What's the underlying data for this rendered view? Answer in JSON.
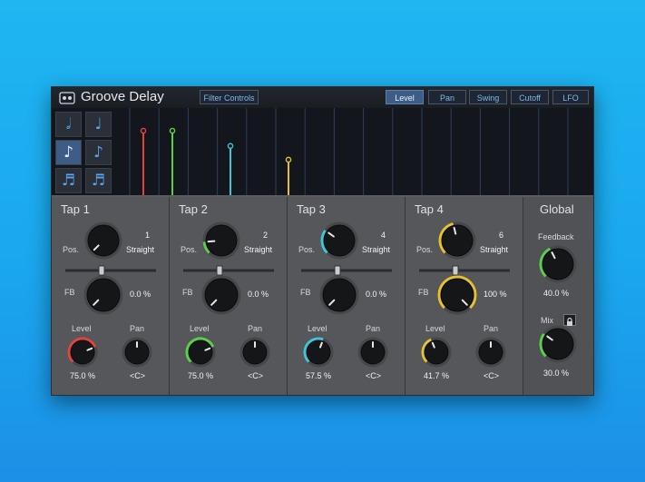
{
  "header": {
    "title": "Groove Delay",
    "filter_button": "Filter Controls",
    "tabs": [
      {
        "label": "Level",
        "active": true
      },
      {
        "label": "Pan",
        "active": false
      },
      {
        "label": "Swing",
        "active": false
      },
      {
        "label": "Cutoff",
        "active": false
      },
      {
        "label": "LFO",
        "active": false
      }
    ]
  },
  "note_buttons": [
    {
      "glyph": "𝅗𝅥",
      "icon": "half-note-icon",
      "selected": false
    },
    {
      "glyph": "♩",
      "icon": "quarter-note-icon",
      "selected": false
    },
    {
      "glyph": "♪",
      "icon": "eighth-note-icon",
      "selected": true
    },
    {
      "glyph": "♪",
      "icon": "eighth-note-icon",
      "selected": false
    },
    {
      "glyph": "♬",
      "icon": "sixteenth-note-icon",
      "selected": false
    },
    {
      "glyph": "♬",
      "icon": "thirtysecond-note-icon",
      "selected": false
    }
  ],
  "timeline_markers": [
    {
      "color": "#e0443c",
      "level": 0.75
    },
    {
      "color": "#5ccf4a",
      "level": 0.75
    },
    {
      "color": "#3ec6d8",
      "level": 0.575
    },
    {
      "color": "#e6c12e",
      "level": 0.417
    }
  ],
  "labels": {
    "pos": "Pos.",
    "fb": "FB",
    "level": "Level",
    "pan": "Pan"
  },
  "taps": [
    {
      "title": "Tap 1",
      "pos_value": "1",
      "pos_mode": "Straight",
      "fb_value": "0.0 %",
      "level_value": "75.0 %",
      "pan_value": "<C>",
      "accent": "#e0443c",
      "level": 0.75,
      "fb": 0.0,
      "pos": 0.0
    },
    {
      "title": "Tap 2",
      "pos_value": "2",
      "pos_mode": "Straight",
      "fb_value": "0.0 %",
      "level_value": "75.0 %",
      "pan_value": "<C>",
      "accent": "#5ccf4a",
      "level": 0.75,
      "fb": 0.0,
      "pos": 0.15
    },
    {
      "title": "Tap 3",
      "pos_value": "4",
      "pos_mode": "Straight",
      "fb_value": "0.0 %",
      "level_value": "57.5 %",
      "pan_value": "<C>",
      "accent": "#3ec6d8",
      "level": 0.575,
      "fb": 0.0,
      "pos": 0.3
    },
    {
      "title": "Tap 4",
      "pos_value": "6",
      "pos_mode": "Straight",
      "fb_value": "100 %",
      "level_value": "41.7 %",
      "pan_value": "<C>",
      "accent": "#e6c12e",
      "level": 0.417,
      "fb": 1.0,
      "pos": 0.45
    }
  ],
  "global": {
    "title": "Global",
    "feedback_label": "Feedback",
    "feedback_value": "40.0 %",
    "mix_label": "Mix",
    "mix_value": "30.0 %",
    "accent": "#5ccf4a",
    "feedback": 0.4,
    "mix": 0.3
  }
}
